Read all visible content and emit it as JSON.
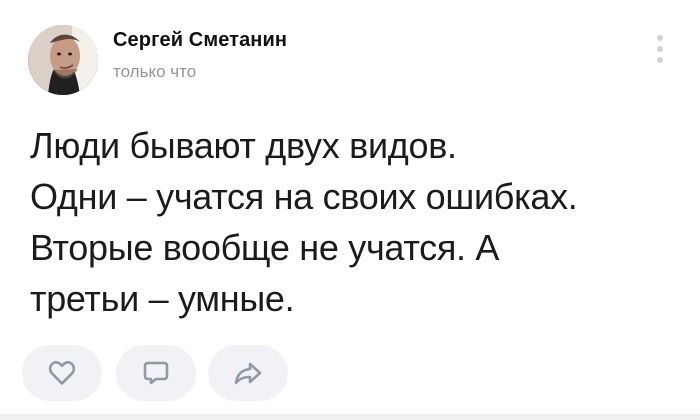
{
  "post": {
    "author": "Сергей Сметанин",
    "timestamp": "только что",
    "text_lines": [
      "Люди бывают двух видов.",
      "Одни – учатся на своих ошибках.",
      "Вторые вообще не учатся. А",
      "третьи  – умные."
    ]
  },
  "actions": [
    {
      "icon": "heart-icon"
    },
    {
      "icon": "comment-icon"
    },
    {
      "icon": "share-icon"
    }
  ],
  "colors": {
    "text": "#1b1b1b",
    "author": "#111111",
    "timestamp": "#8f959c",
    "action_background": "#f0f2f5",
    "icon": "#909aa4"
  }
}
